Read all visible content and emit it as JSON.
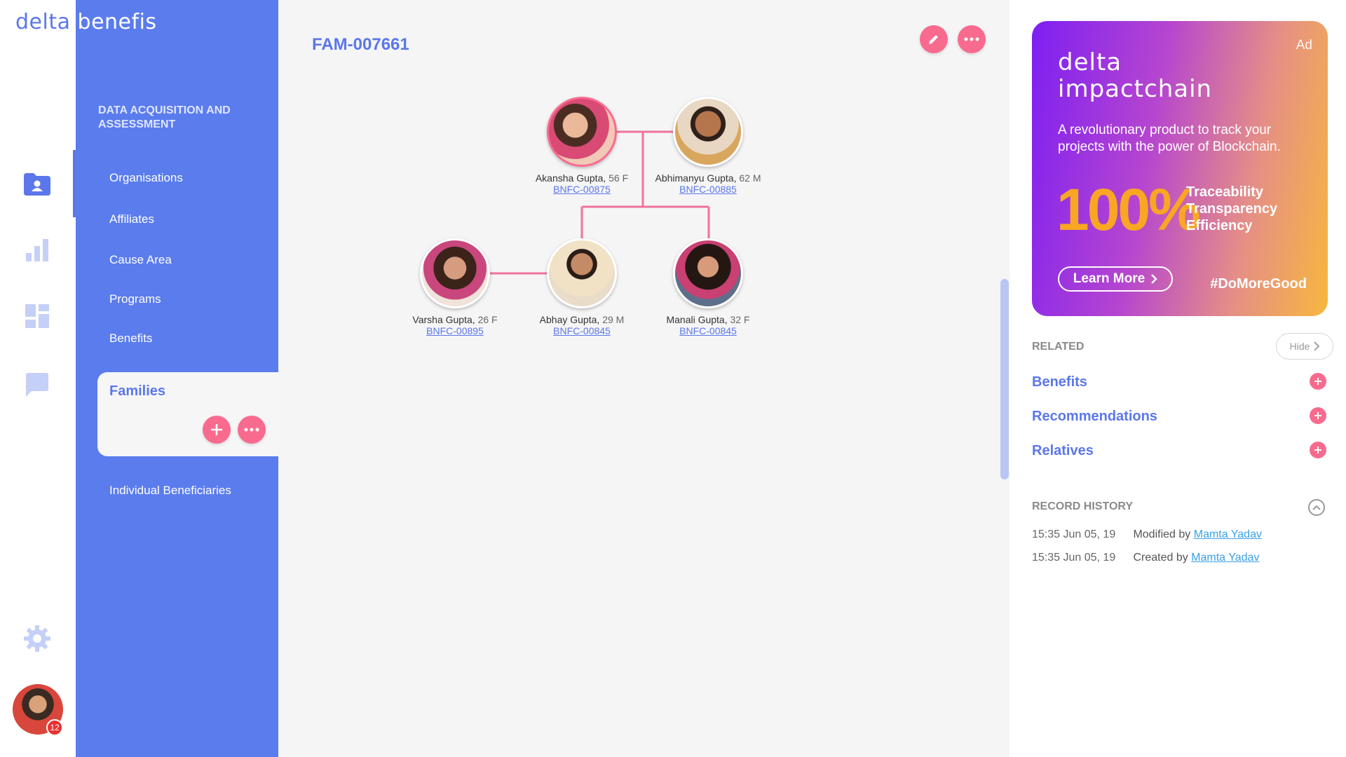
{
  "brand": {
    "part1": "delta",
    "part2": "benefis"
  },
  "rail": {
    "icons": [
      "contacts-folder-icon",
      "bar-chart-icon",
      "dashboard-icon",
      "chat-icon",
      "settings-icon"
    ],
    "notification_count": "12"
  },
  "nav": {
    "section_title": "DATA ACQUISITION AND ASSESSMENT",
    "items": [
      "Organisations",
      "Affiliates",
      "Cause Area",
      "Programs",
      "Benefits"
    ],
    "active_item": "Families",
    "after_items": [
      "Individual Beneficiaries"
    ]
  },
  "page": {
    "title": "FAM-007661"
  },
  "family": {
    "members": [
      {
        "name": "Akansha Gupta,",
        "meta": "56 F",
        "id": "BNFC-00875"
      },
      {
        "name": "Abhimanyu Gupta,",
        "meta": "62 M",
        "id": "BNFC-00885"
      },
      {
        "name": "Varsha Gupta,",
        "meta": "26 F",
        "id": "BNFC-00895"
      },
      {
        "name": "Abhay Gupta,",
        "meta": "29 M",
        "id": "BNFC-00845"
      },
      {
        "name": "Manali Gupta,",
        "meta": "32 F",
        "id": "BNFC-00845"
      }
    ]
  },
  "ad": {
    "tag": "Ad",
    "title_line1": "delta",
    "title_line2": "impactchain",
    "description": "A revolutionary product to track your projects with the power of Blockchain.",
    "big_number": "100%",
    "features": [
      "Traceability",
      "Transparency",
      "Efficiency"
    ],
    "button_label": "Learn More",
    "hashtag": "#DoMoreGood"
  },
  "related": {
    "title": "RELATED",
    "hide_label": "Hide",
    "items": [
      "Benefits",
      "Recommendations",
      "Relatives"
    ]
  },
  "history": {
    "title": "RECORD HISTORY",
    "rows": [
      {
        "time": "15:35 Jun 05, 19",
        "action": "Modified by",
        "user": "Mamta Yadav"
      },
      {
        "time": "15:35 Jun 05, 19",
        "action": "Created by",
        "user": "Mamta Yadav"
      }
    ]
  },
  "colors": {
    "accent": "#5b77ea",
    "pink": "#f86b8f",
    "nav_bg": "#5b7ced"
  }
}
